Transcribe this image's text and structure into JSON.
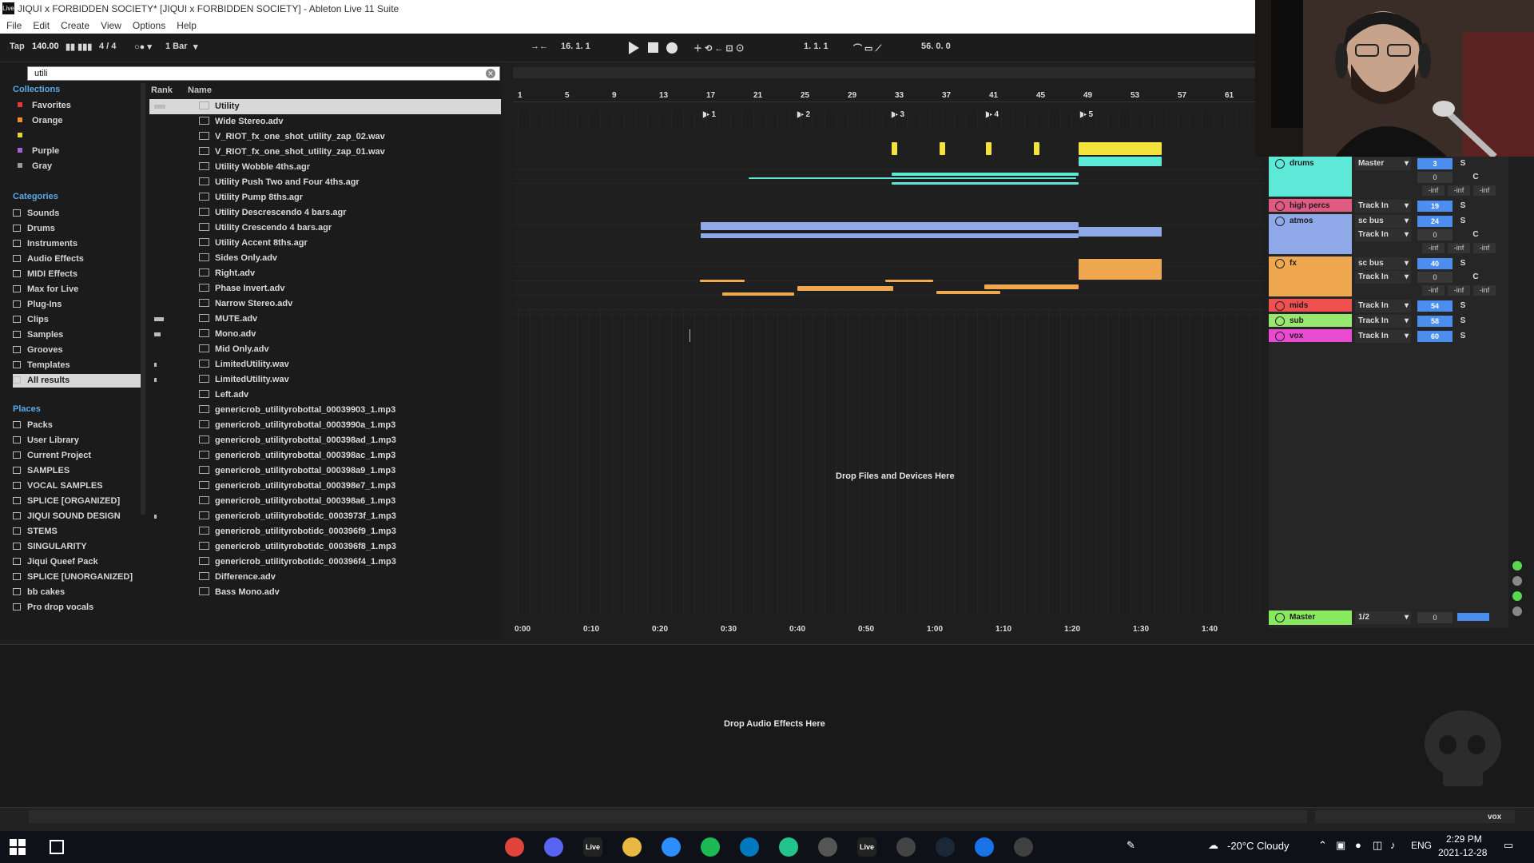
{
  "window": {
    "title": "JIQUI x FORBIDDEN SOCIETY* [JIQUI x FORBIDDEN SOCIETY] - Ableton Live 11 Suite",
    "app_icon": "Live"
  },
  "menu": [
    "File",
    "Edit",
    "Create",
    "View",
    "Options",
    "Help"
  ],
  "control_bar": {
    "tap": "Tap",
    "tempo": "140.00",
    "signature": "4 / 4",
    "quantize": "1 Bar",
    "arrangement_position": "16.  1.  1",
    "loop_start": "1.  1.  1",
    "loop_length": "56.  0.  0"
  },
  "browser": {
    "search_value": "utili",
    "collections_header": "Collections",
    "collections": [
      {
        "label": "Favorites",
        "color": "#e23b3b"
      },
      {
        "label": "Orange",
        "color": "#f0902a"
      },
      {
        "label": "",
        "color": "#e8d23a"
      },
      {
        "label": "Purple",
        "color": "#a45fd0"
      },
      {
        "label": "Gray",
        "color": "#9a9a9a"
      }
    ],
    "categories_header": "Categories",
    "categories": [
      "Sounds",
      "Drums",
      "Instruments",
      "Audio Effects",
      "MIDI Effects",
      "Max for Live",
      "Plug-Ins",
      "Clips",
      "Samples",
      "Grooves",
      "Templates",
      "All results"
    ],
    "places_header": "Places",
    "places": [
      "Packs",
      "User Library",
      "Current Project",
      "SAMPLES",
      "VOCAL SAMPLES",
      "SPLICE [ORGANIZED]",
      "JIQUI SOUND DESIGN",
      "STEMS",
      "SINGULARITY",
      "Jiqui Queef Pack",
      "SPLICE [UNORGANIZED]",
      "bb cakes",
      "Pro drop vocals"
    ],
    "column_rank": "Rank",
    "column_name": "Name",
    "files": [
      "Utility",
      "Wide Stereo.adv",
      "V_RIOT_fx_one_shot_utility_zap_02.wav",
      "V_RIOT_fx_one_shot_utility_zap_01.wav",
      "Utility Wobble 4ths.agr",
      "Utility Push Two and Four 4ths.agr",
      "Utility Pump 8ths.agr",
      "Utility Descrescendo 4 bars.agr",
      "Utility Crescendo 4 bars.agr",
      "Utility Accent 8ths.agr",
      "Sides Only.adv",
      "Right.adv",
      "Phase Invert.adv",
      "Narrow Stereo.adv",
      "MUTE.adv",
      "Mono.adv",
      "Mid Only.adv",
      "LimitedUtility.wav",
      "LimitedUtility.wav",
      "Left.adv",
      "genericrob_utilityrobottal_00039903_1.mp3",
      "genericrob_utilityrobottal_0003990a_1.mp3",
      "genericrob_utilityrobottal_000398ad_1.mp3",
      "genericrob_utilityrobottal_000398ac_1.mp3",
      "genericrob_utilityrobottal_000398a9_1.mp3",
      "genericrob_utilityrobottal_000398e7_1.mp3",
      "genericrob_utilityrobottal_000398a6_1.mp3",
      "genericrob_utilityrobotidc_0003973f_1.mp3",
      "genericrob_utilityrobotidc_000396f9_1.mp3",
      "genericrob_utilityrobotidc_000396f8_1.mp3",
      "genericrob_utilityrobotidc_000396f4_1.mp3",
      "Difference.adv",
      "Bass Mono.adv"
    ]
  },
  "arrangement": {
    "beat_ruler": [
      "1",
      "5",
      "9",
      "13",
      "17",
      "21",
      "25",
      "29",
      "33",
      "37",
      "41",
      "45",
      "49",
      "53",
      "57",
      "61"
    ],
    "locators": [
      "1",
      "2",
      "3",
      "4",
      "5"
    ],
    "time_ruler": [
      "0:00",
      "0:10",
      "0:20",
      "0:30",
      "0:40",
      "0:50",
      "1:00",
      "1:10",
      "1:20",
      "1:30",
      "1:40"
    ],
    "drop_hint": "Drop Files and Devices Here"
  },
  "mixer": {
    "tracks": [
      {
        "name": "drums",
        "color": "#5ee8d8",
        "routing": "Master",
        "volume": "3",
        "pan": "0",
        "pan_c": "C",
        "solo": "S",
        "meters": [
          "-inf",
          "-inf",
          "-inf"
        ]
      },
      {
        "name": "high percs",
        "color": "#e05a83",
        "routing": "Track In",
        "volume": "19",
        "solo": "S"
      },
      {
        "name": "atmos",
        "color": "#8fa8e8",
        "routing": "sc bus",
        "routing2": "Track In",
        "volume": "24",
        "pan": "0",
        "pan_c": "C",
        "solo": "S",
        "meters": [
          "-inf",
          "-inf",
          "-inf"
        ]
      },
      {
        "name": "fx",
        "color": "#f0a850",
        "routing": "sc bus",
        "routing2": "Track In",
        "volume": "40",
        "pan": "0",
        "pan_c": "C",
        "solo": "S",
        "meters": [
          "-inf",
          "-inf",
          "-inf"
        ]
      },
      {
        "name": "mids",
        "color": "#f05050",
        "routing": "Track In",
        "volume": "54",
        "solo": "S"
      },
      {
        "name": "sub",
        "color": "#98e870",
        "routing": "Track In",
        "volume": "58",
        "solo": "S"
      },
      {
        "name": "vox",
        "color": "#e84ad0",
        "routing": "Track In",
        "volume": "60",
        "solo": "S"
      }
    ],
    "master": {
      "name": "Master",
      "color": "#88e860",
      "routing": "1/2",
      "volume": "0"
    }
  },
  "device_area": {
    "drop_hint": "Drop Audio Effects Here"
  },
  "status": {
    "track": "vox"
  },
  "taskbar": {
    "apps": [
      {
        "name": "chrome",
        "color": "#e0443a"
      },
      {
        "name": "discord",
        "color": "#5865f2"
      },
      {
        "name": "live",
        "color": "#222222",
        "label": "Live"
      },
      {
        "name": "explorer",
        "color": "#e8b840"
      },
      {
        "name": "zoom",
        "color": "#2d8cff"
      },
      {
        "name": "spotify",
        "color": "#1db954"
      },
      {
        "name": "trello",
        "color": "#0079bf"
      },
      {
        "name": "app-green",
        "color": "#23c48b"
      },
      {
        "name": "app-compass",
        "color": "#555555"
      },
      {
        "name": "live2",
        "color": "#222222",
        "label": "Live"
      },
      {
        "name": "unity",
        "color": "#444444"
      },
      {
        "name": "steam",
        "color": "#1b2838"
      },
      {
        "name": "app-blue",
        "color": "#1a73e8"
      },
      {
        "name": "obs",
        "color": "#404040"
      }
    ],
    "weather": "-20°C  Cloudy",
    "lang": "ENG",
    "time": "2:29 PM",
    "date": "2021-12-28"
  }
}
